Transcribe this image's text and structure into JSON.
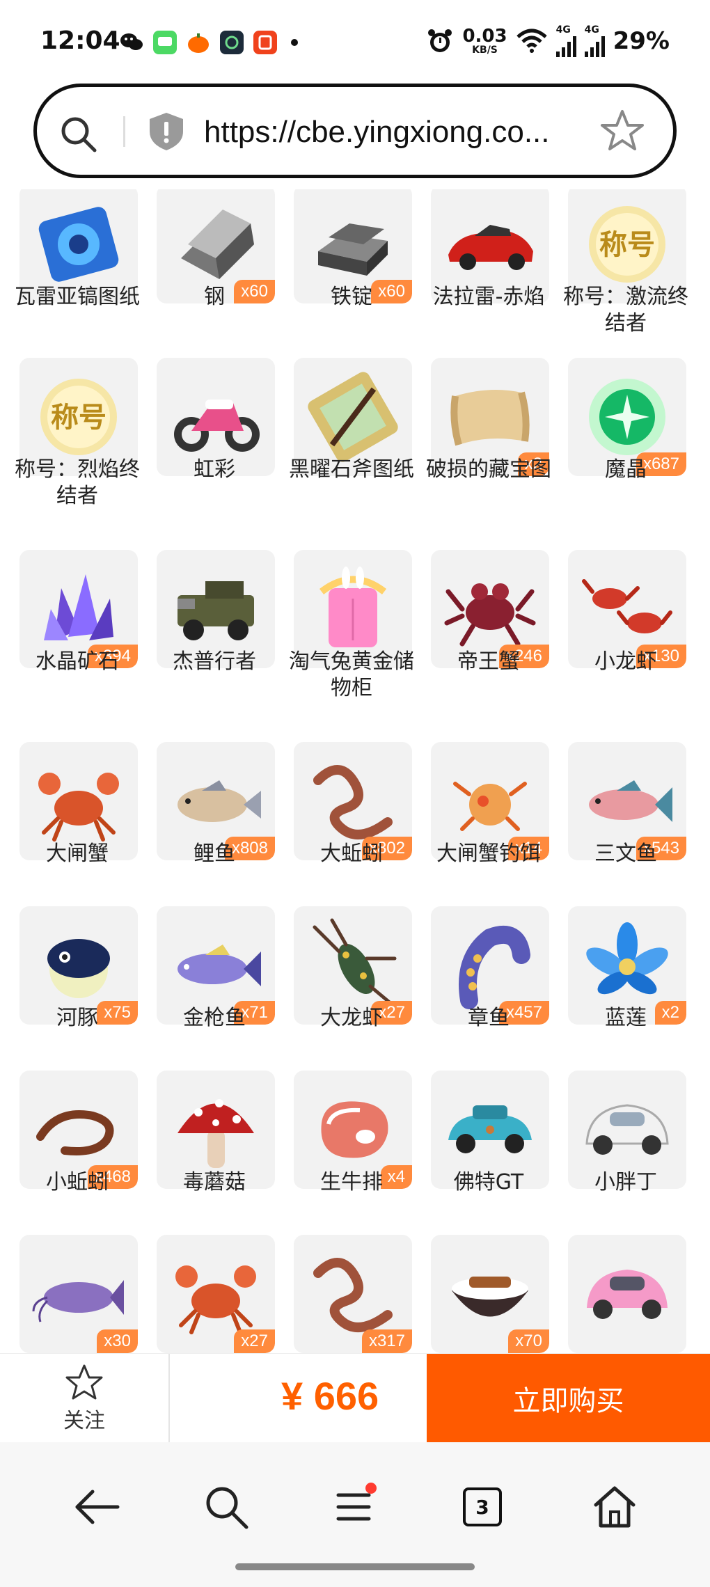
{
  "status_bar": {
    "time": "12:04",
    "speed_value": "0.03",
    "speed_unit": "KB/S",
    "network_1": "4G",
    "network_2": "4G",
    "battery": "29%",
    "notification_icons": [
      "wechat-icon",
      "message-icon",
      "pumpkin-game-icon",
      "shield-app-icon",
      "listen-app-icon"
    ]
  },
  "url_bar": {
    "url": "https://cbe.yingxiong.co..."
  },
  "items": [
    {
      "name": "瓦雷亚镐图纸",
      "qty": "",
      "icon": "blueprint-blue-icon"
    },
    {
      "name": "钢",
      "qty": "x60",
      "icon": "steel-bar-icon"
    },
    {
      "name": "铁锭",
      "qty": "x60",
      "icon": "iron-ingot-icon"
    },
    {
      "name": "法拉雷-赤焰",
      "qty": "",
      "icon": "red-sportscar-icon"
    },
    {
      "name": "称号：激流终结者",
      "qty": "",
      "icon": "title-badge-icon"
    },
    {
      "name": "称号：烈焰终结者",
      "qty": "",
      "icon": "title-badge-icon"
    },
    {
      "name": "虹彩",
      "qty": "",
      "icon": "motorcycle-icon"
    },
    {
      "name": "黑曜石斧图纸",
      "qty": "",
      "icon": "axe-blueprint-icon"
    },
    {
      "name": "破损的藏宝图",
      "qty": "x2",
      "icon": "treasure-map-icon"
    },
    {
      "name": "魔晶",
      "qty": "x687",
      "icon": "magic-crystal-icon"
    },
    {
      "name": "水晶矿石",
      "qty": "x394",
      "icon": "crystal-ore-icon"
    },
    {
      "name": "杰普行者",
      "qty": "",
      "icon": "jeep-icon"
    },
    {
      "name": "淘气兔黄金储物柜",
      "qty": "",
      "icon": "bunny-cabinet-icon"
    },
    {
      "name": "帝王蟹",
      "qty": "x246",
      "icon": "king-crab-icon"
    },
    {
      "name": "小龙虾",
      "qty": "x130",
      "icon": "crayfish-icon"
    },
    {
      "name": "大闸蟹",
      "qty": "",
      "icon": "crab-icon"
    },
    {
      "name": "鲤鱼",
      "qty": "x808",
      "icon": "carp-icon"
    },
    {
      "name": "大蚯蚓",
      "qty": "x802",
      "icon": "worm-icon"
    },
    {
      "name": "大闸蟹钓饵",
      "qty": "x14",
      "icon": "crab-bait-icon"
    },
    {
      "name": "三文鱼",
      "qty": "x543",
      "icon": "salmon-icon"
    },
    {
      "name": "河豚",
      "qty": "x75",
      "icon": "pufferfish-icon"
    },
    {
      "name": "金枪鱼",
      "qty": "x71",
      "icon": "tuna-icon"
    },
    {
      "name": "大龙虾",
      "qty": "x27",
      "icon": "lobster-icon"
    },
    {
      "name": "章鱼",
      "qty": "x457",
      "icon": "octopus-tentacle-icon"
    },
    {
      "name": "蓝莲",
      "qty": "x2",
      "icon": "blue-lotus-icon"
    },
    {
      "name": "小蚯蚓",
      "qty": "x468",
      "icon": "small-worm-icon"
    },
    {
      "name": "毒蘑菇",
      "qty": "",
      "icon": "mushroom-icon"
    },
    {
      "name": "生牛排",
      "qty": "x4",
      "icon": "steak-icon"
    },
    {
      "name": "佛特GT",
      "qty": "",
      "icon": "rusty-car-icon"
    },
    {
      "name": "小胖丁",
      "qty": "",
      "icon": "white-beetle-car-icon"
    },
    {
      "name": "",
      "qty": "x30",
      "icon": "catfish-icon"
    },
    {
      "name": "",
      "qty": "x27",
      "icon": "crab-icon"
    },
    {
      "name": "",
      "qty": "x317",
      "icon": "worm-icon"
    },
    {
      "name": "",
      "qty": "x70",
      "icon": "rice-bowl-icon"
    },
    {
      "name": "",
      "qty": "",
      "icon": "pink-beetle-car-icon"
    }
  ],
  "action_bar": {
    "follow_label": "关注",
    "price": "¥ 666",
    "buy_label": "立即购买"
  },
  "nav": {
    "tab_count": "3"
  },
  "colors": {
    "accent": "#ff5a00",
    "price": "#ff6000",
    "qty_badge": "#ff8a3d"
  }
}
